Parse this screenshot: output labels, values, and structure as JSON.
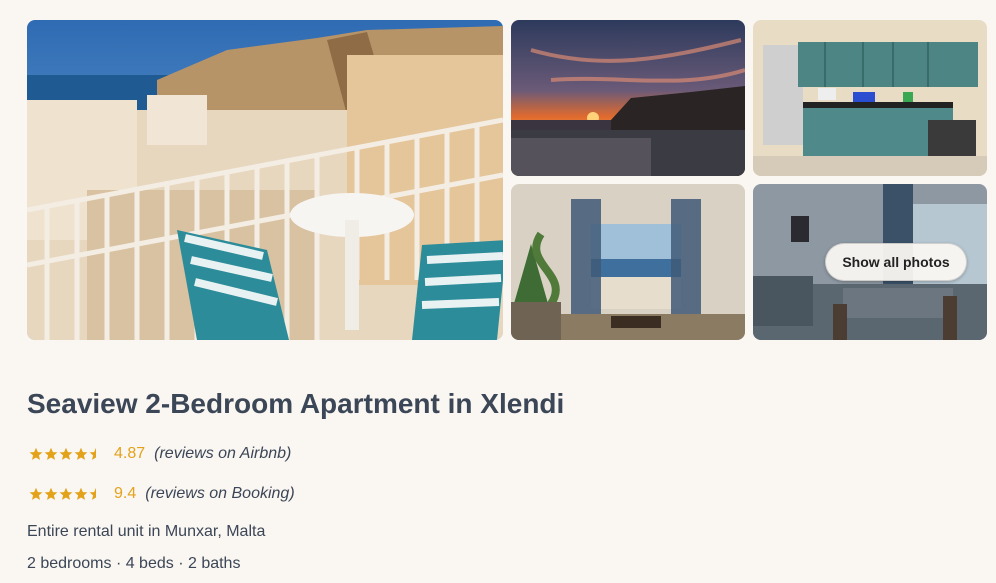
{
  "gallery": {
    "show_all_label": "Show all photos"
  },
  "listing": {
    "title": "Seaview 2-Bedroom Apartment in Xlendi",
    "ratings": [
      {
        "score": "4.87",
        "stars": 4.5,
        "source": "(reviews on Airbnb)"
      },
      {
        "score": "9.4",
        "stars": 4.5,
        "source": "(reviews on Booking)"
      }
    ],
    "unit_type": "Entire rental unit in Munxar, Malta",
    "specs": "2 bedrooms · 4 beds · 2 baths"
  },
  "colors": {
    "accent_star": "#e3a21a",
    "text": "#3b4656",
    "background": "#faf6f2"
  }
}
